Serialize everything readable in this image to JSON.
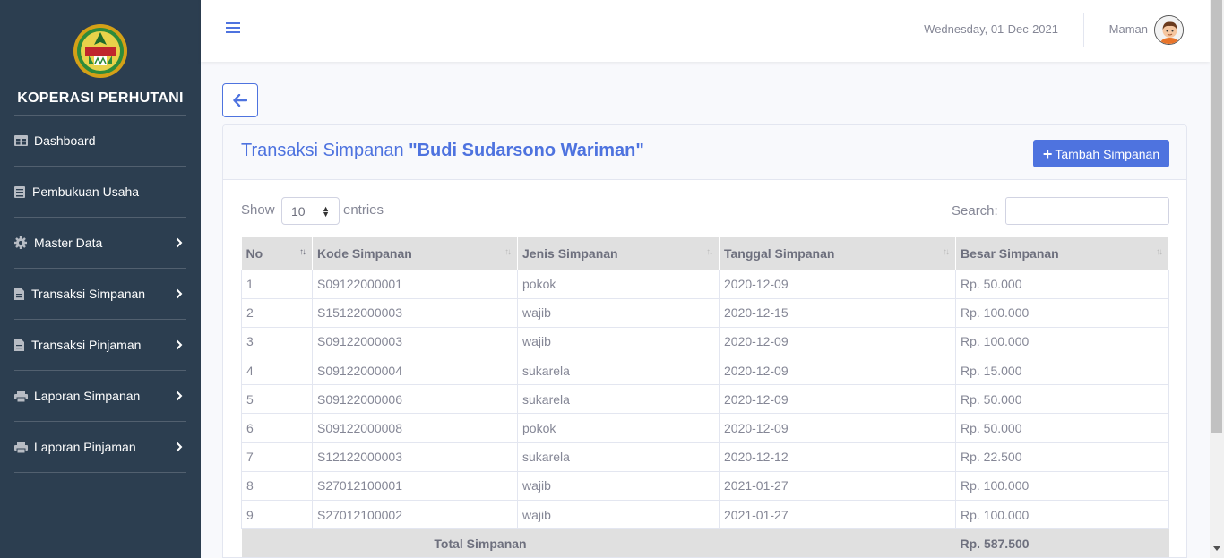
{
  "sidebar": {
    "brand": "KOPERASI PERHUTANI",
    "items": [
      {
        "label": "Dashboard",
        "icon": "table-icon",
        "has_submenu": false
      },
      {
        "label": "Pembukuan Usaha",
        "icon": "book-icon",
        "has_submenu": false
      },
      {
        "label": "Master Data",
        "icon": "gear-icon",
        "has_submenu": true
      },
      {
        "label": "Transaksi Simpanan",
        "icon": "file-icon",
        "has_submenu": true
      },
      {
        "label": "Transaksi Pinjaman",
        "icon": "file-icon",
        "has_submenu": true
      },
      {
        "label": "Laporan Simpanan",
        "icon": "print-icon",
        "has_submenu": true
      },
      {
        "label": "Laporan Pinjaman",
        "icon": "print-icon",
        "has_submenu": true
      }
    ]
  },
  "topbar": {
    "date": "Wednesday, 01-Dec-2021",
    "user": "Maman"
  },
  "card": {
    "title_prefix": "Transaksi Simpanan ",
    "title_name": "\"Budi Sudarsono Wariman\"",
    "add_button": "Tambah Simpanan"
  },
  "datatable": {
    "show_label": "Show",
    "page_length": "10",
    "entries_label": "entries",
    "search_label": "Search:",
    "search_value": "",
    "columns": [
      "No",
      "Kode Simpanan",
      "Jenis Simpanan",
      "Tanggal Simpanan",
      "Besar Simpanan"
    ],
    "rows": [
      [
        "1",
        "S09122000001",
        "pokok",
        "2020-12-09",
        "Rp. 50.000"
      ],
      [
        "2",
        "S15122000003",
        "wajib",
        "2020-12-15",
        "Rp. 100.000"
      ],
      [
        "3",
        "S09122000003",
        "wajib",
        "2020-12-09",
        "Rp. 100.000"
      ],
      [
        "4",
        "S09122000004",
        "sukarela",
        "2020-12-09",
        "Rp. 15.000"
      ],
      [
        "5",
        "S09122000006",
        "sukarela",
        "2020-12-09",
        "Rp. 50.000"
      ],
      [
        "6",
        "S09122000008",
        "pokok",
        "2020-12-09",
        "Rp. 50.000"
      ],
      [
        "7",
        "S12122000003",
        "sukarela",
        "2020-12-12",
        "Rp. 22.500"
      ],
      [
        "8",
        "S27012100001",
        "wajib",
        "2021-01-27",
        "Rp. 100.000"
      ],
      [
        "9",
        "S27012100002",
        "wajib",
        "2021-01-27",
        "Rp. 100.000"
      ]
    ],
    "footer": {
      "label": "Total Simpanan",
      "total": "Rp. 587.500"
    }
  },
  "colors": {
    "sidebar_bg": "#2c3e50",
    "primary": "#4e73df",
    "text_muted": "#858796"
  }
}
